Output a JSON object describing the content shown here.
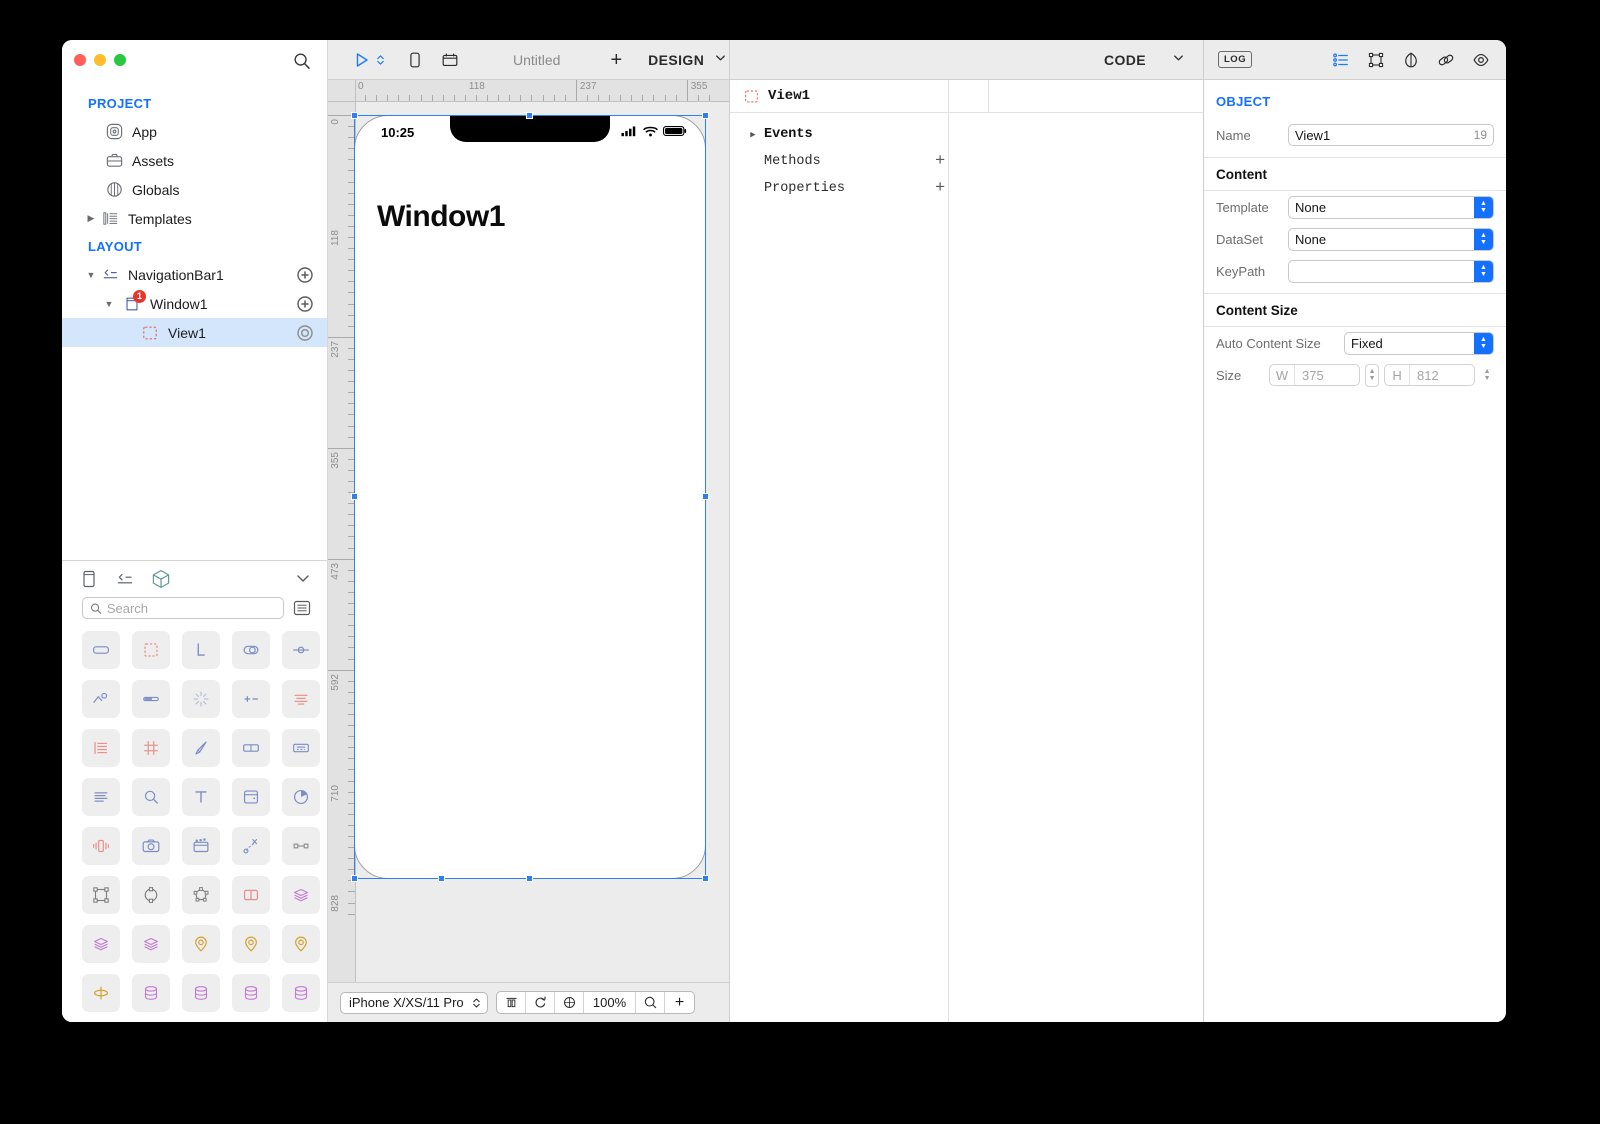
{
  "window": {
    "traffic_lights": [
      "close",
      "minimize",
      "zoom"
    ]
  },
  "sidebar": {
    "search_icon": "search-icon",
    "sections": [
      {
        "title": "PROJECT",
        "items": [
          {
            "label": "App",
            "icon": "app-icon",
            "disclosure": "none",
            "indent": 1,
            "action": "none",
            "badge": ""
          },
          {
            "label": "Assets",
            "icon": "assets-briefcase-icon",
            "disclosure": "none",
            "indent": 1,
            "action": "none",
            "badge": ""
          },
          {
            "label": "Globals",
            "icon": "globals-icon",
            "disclosure": "none",
            "indent": 1,
            "action": "none",
            "badge": ""
          },
          {
            "label": "Templates",
            "icon": "templates-icon",
            "disclosure": "closed",
            "indent": 0,
            "action": "none",
            "badge": ""
          }
        ]
      },
      {
        "title": "LAYOUT",
        "items": [
          {
            "label": "NavigationBar1",
            "icon": "navigationbar-icon",
            "disclosure": "open",
            "indent": 0,
            "action": "add",
            "badge": ""
          },
          {
            "label": "Window1",
            "icon": "window-icon",
            "disclosure": "open",
            "indent": 1,
            "action": "add",
            "badge": "1"
          },
          {
            "label": "View1",
            "icon": "view-dashed-icon",
            "disclosure": "none",
            "indent": 2,
            "action": "target",
            "badge": "",
            "selected": true
          }
        ]
      }
    ],
    "palette": {
      "tabs": [
        "panel-icon",
        "navigationbar-icon",
        "cube-icon"
      ],
      "collapse_icon": "chevron-down-icon",
      "search_placeholder": "Search",
      "search_value": "",
      "list_mode_icon": "list-view-icon",
      "icons": [
        "rounded-rect-icon",
        "dashed-rect-icon",
        "label-L-icon",
        "toggle-icon",
        "slider-icon",
        "chart-scatter-icon",
        "progress-bar-icon",
        "activity-spinner-icon",
        "stepper-icon",
        "equalizer-icon",
        "list-icon",
        "grid-icon",
        "pen-icon",
        "segmented-icon",
        "picker-icon",
        "text-lines-icon",
        "search-icon",
        "text-T-icon",
        "web-view-icon",
        "pie-chart-icon",
        "vibrate-icon",
        "camera-icon",
        "video-icon",
        "motion-path-icon",
        "link-nodes-icon",
        "bounds-icon",
        "circle-nodes-icon",
        "polygon-nodes-icon",
        "split-view-icon",
        "layers-icon",
        "layers-icon",
        "layers-icon",
        "map-pin-icon",
        "map-pin-icon",
        "map-pin-icon",
        "orbit-icon",
        "database-icon",
        "database-icon",
        "database-icon",
        "database-icon"
      ]
    }
  },
  "canvas": {
    "toolbar": {
      "run_icon": "run-play-icon",
      "run_caret_icon": "chevron-updown-icon",
      "device_icon": "device-phone-icon",
      "layout_icon": "layout-grid-icon",
      "document_title": "Untitled",
      "add_label": "+",
      "mode_label": "DESIGN",
      "mode_caret_icon": "chevron-down-icon"
    },
    "ruler": {
      "horizontal_ticks": [
        "0",
        "118",
        "237",
        "355"
      ],
      "vertical_ticks": [
        "0",
        "118",
        "237",
        "355",
        "473",
        "592",
        "710",
        "828"
      ]
    },
    "phone": {
      "status_time": "10:25",
      "status_icons": [
        "cellular-signal-icon",
        "wifi-icon",
        "battery-icon"
      ],
      "screen_title": "Window1"
    },
    "bottom": {
      "device_name": "iPhone X/XS/11 Pro",
      "device_caret_icon": "chevron-updown-icon",
      "align_icon": "align-icon",
      "rotate_icon": "rotate-icon",
      "fit_icon": "fit-screen-icon",
      "zoom_level": "100%",
      "zoom_out_icon": "zoom-out-icon",
      "zoom_in_label": "+"
    }
  },
  "outline": {
    "toolbar": {
      "code_label": "CODE",
      "code_caret_icon": "chevron-down-icon"
    },
    "header": {
      "icon": "view-dashed-icon",
      "title": "View1"
    },
    "rows": [
      {
        "label": "Events",
        "disclosure": "closed",
        "action": "none",
        "bold": true
      },
      {
        "label": "Methods",
        "disclosure": "none",
        "action": "add",
        "bold": false
      },
      {
        "label": "Properties",
        "disclosure": "none",
        "action": "add",
        "bold": false
      }
    ]
  },
  "inspector": {
    "toolbar": {
      "log_label": "LOG",
      "icons": [
        "attributes-list-icon",
        "bounds-icon",
        "appearance-icon",
        "bindings-link-icon",
        "visibility-eye-icon"
      ]
    },
    "title": "OBJECT",
    "name_label": "Name",
    "name_value": "View1",
    "name_id": "19",
    "content_group": "Content",
    "fields": [
      {
        "label": "Template",
        "value": "None",
        "type": "combo"
      },
      {
        "label": "DataSet",
        "value": "None",
        "type": "combo"
      },
      {
        "label": "KeyPath",
        "value": "",
        "type": "combo"
      }
    ],
    "content_size_group": "Content Size",
    "auto_content_size_label": "Auto Content Size",
    "auto_content_size_value": "Fixed",
    "size_label": "Size",
    "size_w_key": "W",
    "size_w_value": "375",
    "size_h_key": "H",
    "size_h_value": "812"
  },
  "colors": {
    "accent_blue": "#1471ff",
    "selection_blue": "#2f7ff0",
    "selected_row": "#d4e6fb",
    "badge_red": "#e8352a",
    "chrome_gray": "#ececec"
  }
}
